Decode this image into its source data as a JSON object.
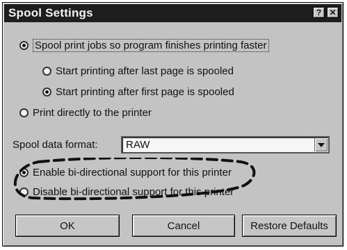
{
  "dialog": {
    "title": "Spool Settings",
    "help_button": "?",
    "close_button": "✕"
  },
  "options": {
    "spool": "Spool print jobs so program finishes printing faster",
    "after_last": "Start printing after last page is spooled",
    "after_first": "Start printing after first page is spooled",
    "direct": "Print directly to the printer",
    "enable_bidi": "Enable bi-directional support for this printer",
    "disable_bidi": "Disable bi-directional support for this printer"
  },
  "format": {
    "label": "Spool data format:",
    "value": "RAW"
  },
  "buttons": {
    "ok": "OK",
    "cancel": "Cancel",
    "restore": "Restore Defaults"
  }
}
